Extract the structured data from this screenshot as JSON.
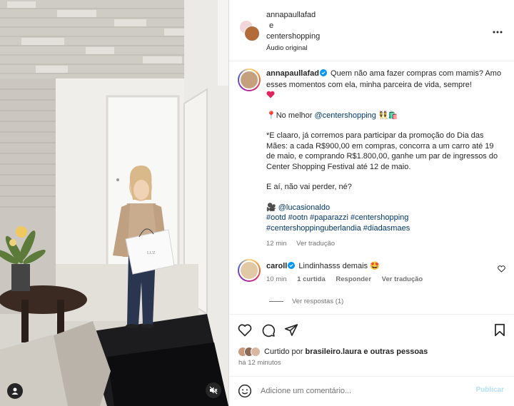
{
  "header": {
    "user1": "annapaullafad",
    "connector": "e",
    "user2": "centershopping",
    "audio": "Áudio original"
  },
  "caption": {
    "username": "annapaullafad",
    "line1": "Quem não ama fazer compras com mamis? Amo esses momentos com ela, minha parceira de vida, sempre!",
    "heart_emoji": "❤️",
    "location_pin": "📍",
    "location_prefix": "No melhor",
    "location_mention": "@centershopping",
    "location_emojis": "👯🛍️",
    "promo": "*E claaro, já corremos para participar da promoção do Dia das Mães: a cada R$900,00 em compras, concorra a um carro até 19 de maio, e comprando R$1.800,00, ganhe um par de ingressos do Center Shopping Festival até 12 de maio.",
    "question": "E aí, não vai perder, né?",
    "camera_emoji": "🎥",
    "credit": "@lucasionaldo",
    "hashtags1": "#ootd #ootn #paparazzi #centershopping",
    "hashtags2": "#centershoppinguberlandia #diadasmaes",
    "time": "12 min",
    "translate": "Ver tradução"
  },
  "comment": {
    "username": "caroll",
    "text": "Lindinhasss demais",
    "emoji": "🤩",
    "time": "10 min",
    "likes": "1 curtida",
    "reply": "Responder",
    "translate": "Ver tradução",
    "view_replies": "Ver respostas (1)"
  },
  "likes": {
    "prefix": "Curtido por",
    "user": "brasileiro.laura",
    "suffix": "e outras pessoas",
    "time": "há 12 minutos"
  },
  "composer": {
    "placeholder": "Adicione um comentário...",
    "publish": "Publicar"
  },
  "colors": {
    "verified": "#0095f6",
    "link": "#00376b",
    "muted": "#737373",
    "publish_disabled": "#b2dffc"
  },
  "icons": [
    "more-icon",
    "verified-icon",
    "heart-icon",
    "comment-icon",
    "share-icon",
    "save-icon",
    "emoji-icon",
    "user-tag-icon",
    "mute-icon"
  ]
}
